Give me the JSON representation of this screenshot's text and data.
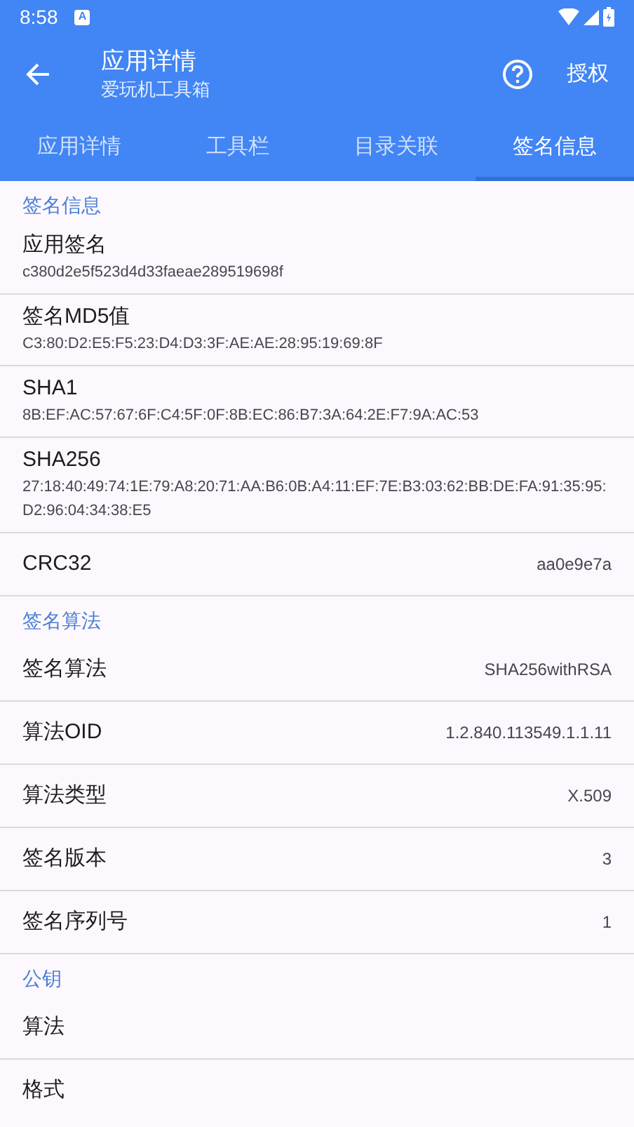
{
  "status_bar": {
    "time": "8:58",
    "notification": "A"
  },
  "app_bar": {
    "title": "应用详情",
    "subtitle": "爱玩机工具箱",
    "action": "授权"
  },
  "tabs": [
    {
      "label": "应用详情",
      "selected": false
    },
    {
      "label": "工具栏",
      "selected": false
    },
    {
      "label": "目录关联",
      "selected": false
    },
    {
      "label": "签名信息",
      "selected": true
    }
  ],
  "sections": [
    {
      "header": "签名信息",
      "items": [
        {
          "kind": "stacked",
          "label": "应用签名",
          "value": "c380d2e5f523d4d33faeae289519698f"
        },
        {
          "kind": "stacked",
          "label": "签名MD5值",
          "value": "C3:80:D2:E5:F5:23:D4:D3:3F:AE:AE:28:95:19:69:8F"
        },
        {
          "kind": "stacked",
          "label": "SHA1",
          "value": "8B:EF:AC:57:67:6F:C4:5F:0F:8B:EC:86:B7:3A:64:2E:F7:9A:AC:53"
        },
        {
          "kind": "stacked",
          "label": "SHA256",
          "value": "27:18:40:49:74:1E:79:A8:20:71:AA:B6:0B:A4:11:EF:7E:B3:03:62:BB:DE:FA:91:35:95:D2:96:04:34:38:E5"
        },
        {
          "kind": "inline",
          "label": "CRC32",
          "value": "aa0e9e7a"
        }
      ]
    },
    {
      "header": "签名算法",
      "items": [
        {
          "kind": "inline",
          "label": "签名算法",
          "value": "SHA256withRSA"
        },
        {
          "kind": "inline",
          "label": "算法OID",
          "value": "1.2.840.113549.1.1.11"
        },
        {
          "kind": "inline",
          "label": "算法类型",
          "value": "X.509"
        },
        {
          "kind": "inline",
          "label": "签名版本",
          "value": "3"
        },
        {
          "kind": "inline",
          "label": "签名序列号",
          "value": "1"
        }
      ]
    },
    {
      "header": "公钥",
      "items": [
        {
          "kind": "inline",
          "label": "算法"
        },
        {
          "kind": "inline",
          "label": "格式"
        }
      ]
    }
  ]
}
